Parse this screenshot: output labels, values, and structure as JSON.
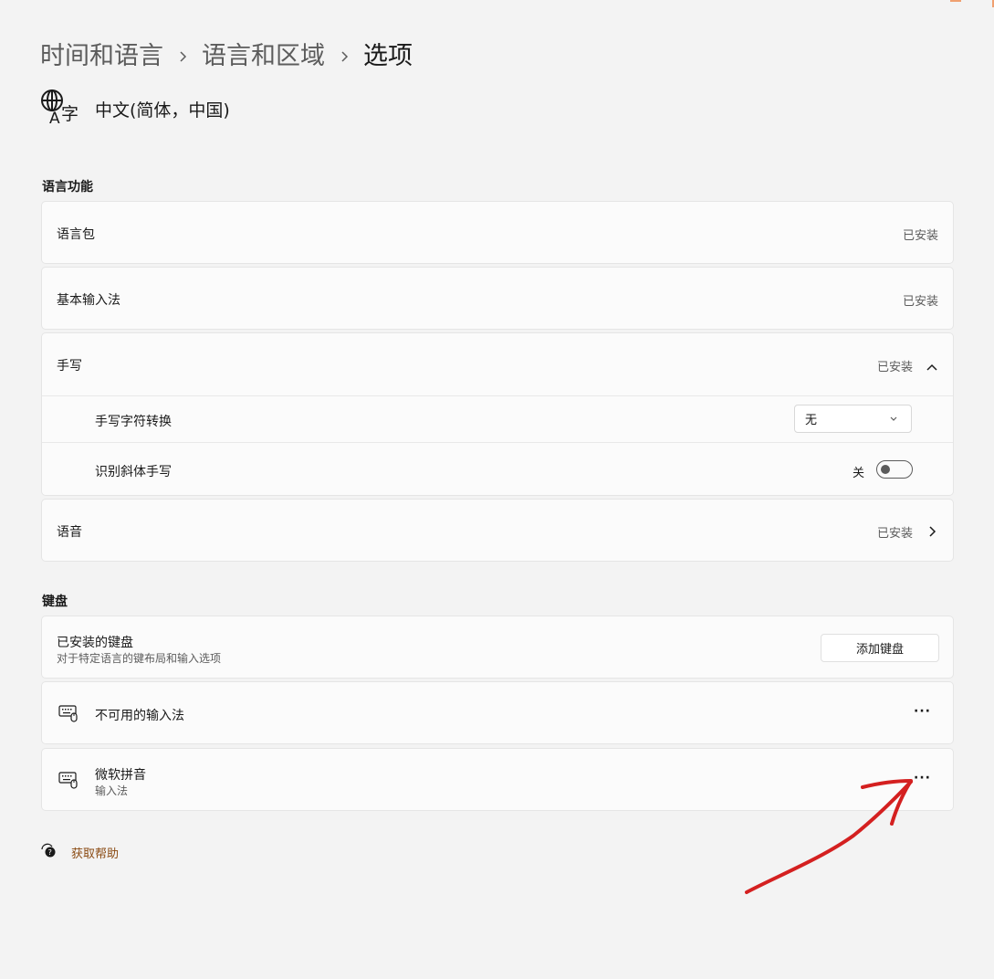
{
  "breadcrumb": {
    "items": [
      "时间和语言",
      "语言和区域"
    ],
    "current": "选项"
  },
  "language": {
    "icon": "language-icon",
    "title": "中文(简体，中国)"
  },
  "language_features": {
    "section_label": "语言功能",
    "items": [
      {
        "label": "语言包",
        "status": "已安装"
      },
      {
        "label": "基本输入法",
        "status": "已安装"
      },
      {
        "label": "手写",
        "status": "已安装"
      },
      {
        "label": "语音",
        "status": "已安装"
      }
    ],
    "handwriting": {
      "conversion_label": "手写字符转换",
      "conversion_value": "无",
      "cursive_label": "识别斜体手写",
      "cursive_state": "关"
    }
  },
  "keyboard": {
    "section_label": "键盘",
    "installed_title": "已安装的键盘",
    "installed_desc": "对于特定语言的键布局和输入选项",
    "add_button": "添加键盘",
    "items": [
      {
        "name": "不可用的输入法",
        "sub": "",
        "more": "···"
      },
      {
        "name": "微软拼音",
        "sub": "输入法",
        "more": "···"
      }
    ]
  },
  "help": {
    "label": "获取帮助"
  },
  "colors": {
    "accent_link": "#8a4a12",
    "annotation": "#d42020"
  }
}
